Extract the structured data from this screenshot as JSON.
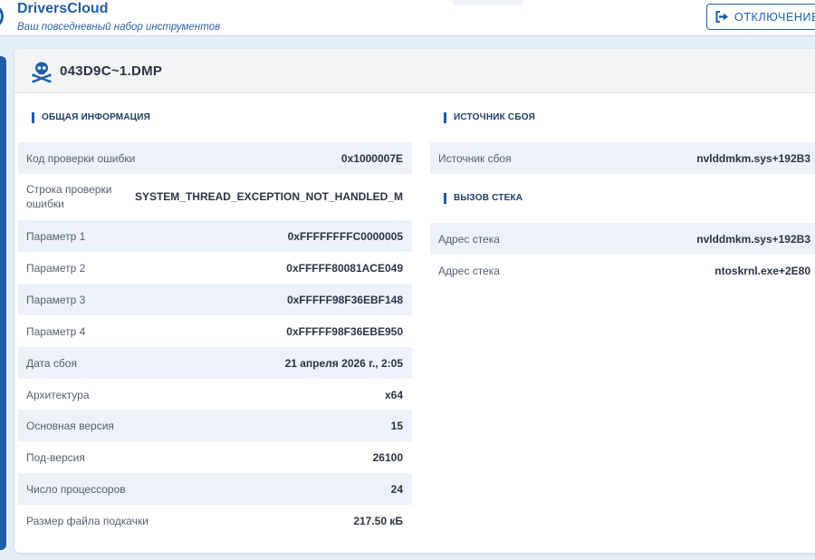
{
  "brand": {
    "title": "DriversCloud",
    "subtitle": "Ваш повседневный набор инструментов"
  },
  "header": {
    "logout_label": "ОТКЛЮЧЕНИЕ",
    "logout_icon": "sign-out-icon"
  },
  "card": {
    "icon": "skull-crossbones-icon",
    "title": "043D9C~1.DMP"
  },
  "general": {
    "title": "ОБЩАЯ ИНФОРМАЦИЯ",
    "rows": [
      {
        "label": "Код проверки ошибки",
        "value": "0x1000007E"
      },
      {
        "label": "Строка проверки ошибки",
        "value": "SYSTEM_THREAD_EXCEPTION_NOT_HANDLED_M"
      },
      {
        "label": "Параметр 1",
        "value": "0xFFFFFFFFC0000005"
      },
      {
        "label": "Параметр 2",
        "value": "0xFFFFF80081ACE049"
      },
      {
        "label": "Параметр 3",
        "value": "0xFFFFF98F36EBF148"
      },
      {
        "label": "Параметр 4",
        "value": "0xFFFFF98F36EBE950"
      },
      {
        "label": "Дата сбоя",
        "value": "21 апреля 2026 г., 2:05"
      },
      {
        "label": "Архитектура",
        "value": "x64"
      },
      {
        "label": "Основная версия",
        "value": "15"
      },
      {
        "label": "Под-версия",
        "value": "26100"
      },
      {
        "label": "Число процессоров",
        "value": "24"
      },
      {
        "label": "Размер файла подкачки",
        "value": "217.50 кБ"
      }
    ]
  },
  "crash_source": {
    "title": "ИСТОЧНИК СБОЯ",
    "rows": [
      {
        "label": "Источник сбоя",
        "value": "nvlddmkm.sys+192B3"
      }
    ]
  },
  "call_stack": {
    "title": "ВЫЗОВ СТЕКА",
    "rows": [
      {
        "label": "Адрес стека",
        "value": "nvlddmkm.sys+192B3"
      },
      {
        "label": "Адрес стека",
        "value": "ntoskrnl.exe+2E80"
      }
    ]
  }
}
